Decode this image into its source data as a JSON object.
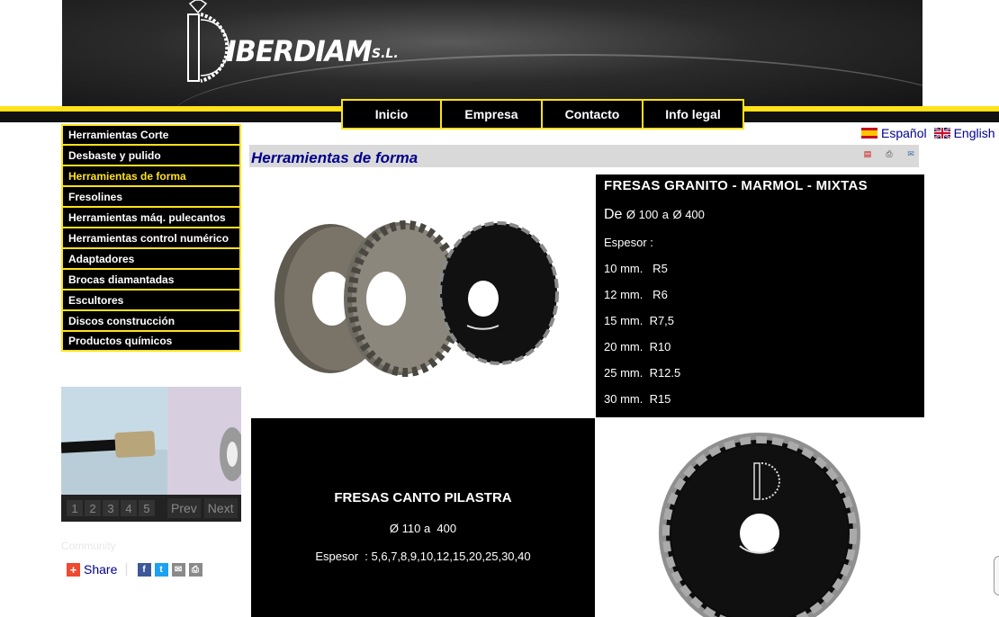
{
  "brand": {
    "name": "IBERDIAM",
    "suffix": "S.L."
  },
  "top_nav": [
    "Inicio",
    "Empresa",
    "Contacto",
    "Info legal"
  ],
  "languages": [
    {
      "label": "Español",
      "flag": "flag-es-icon"
    },
    {
      "label": "English",
      "flag": "flag-gb-icon"
    }
  ],
  "sidebar": {
    "items": [
      "Herramientas Corte",
      "Desbaste y pulido",
      "Herramientas de forma",
      "Fresolines",
      "Herramientas máq. pulecantos",
      "Herramientas control numérico",
      "Adaptadores",
      "Brocas diamantadas",
      "Escultores",
      "Discos construcción",
      "Productos químicos"
    ],
    "active_index": 2
  },
  "slideshow": {
    "pages": [
      "1",
      "2",
      "3",
      "4",
      "5"
    ],
    "prev": "Prev",
    "next": "Next"
  },
  "share": {
    "label": "Community",
    "text": "Share"
  },
  "main": {
    "title": "Herramientas de forma",
    "block1": {
      "title": "FRESAS  GRANITO - MARMOL - MIXTAS",
      "range_prefix": "De",
      "range_from": "Ø 100",
      "range_mid": "a",
      "range_to": "Ø 400",
      "thickness_label": "Espesor :",
      "lines": [
        "10 mm.   R5",
        "12 mm.   R6",
        "15 mm.  R7,5",
        "20 mm.  R10",
        "25 mm.  R12.5",
        "30 mm.  R15"
      ]
    },
    "block2": {
      "title": "FRESAS CANTO PILASTRA",
      "range": "Ø 110 a  400",
      "thickness": "Espesor  : 5,6,7,8,9,10,12,15,20,25,30,40"
    }
  },
  "colors": {
    "accent": "#ffe21a",
    "link": "#00008b",
    "panel": "#000000"
  }
}
